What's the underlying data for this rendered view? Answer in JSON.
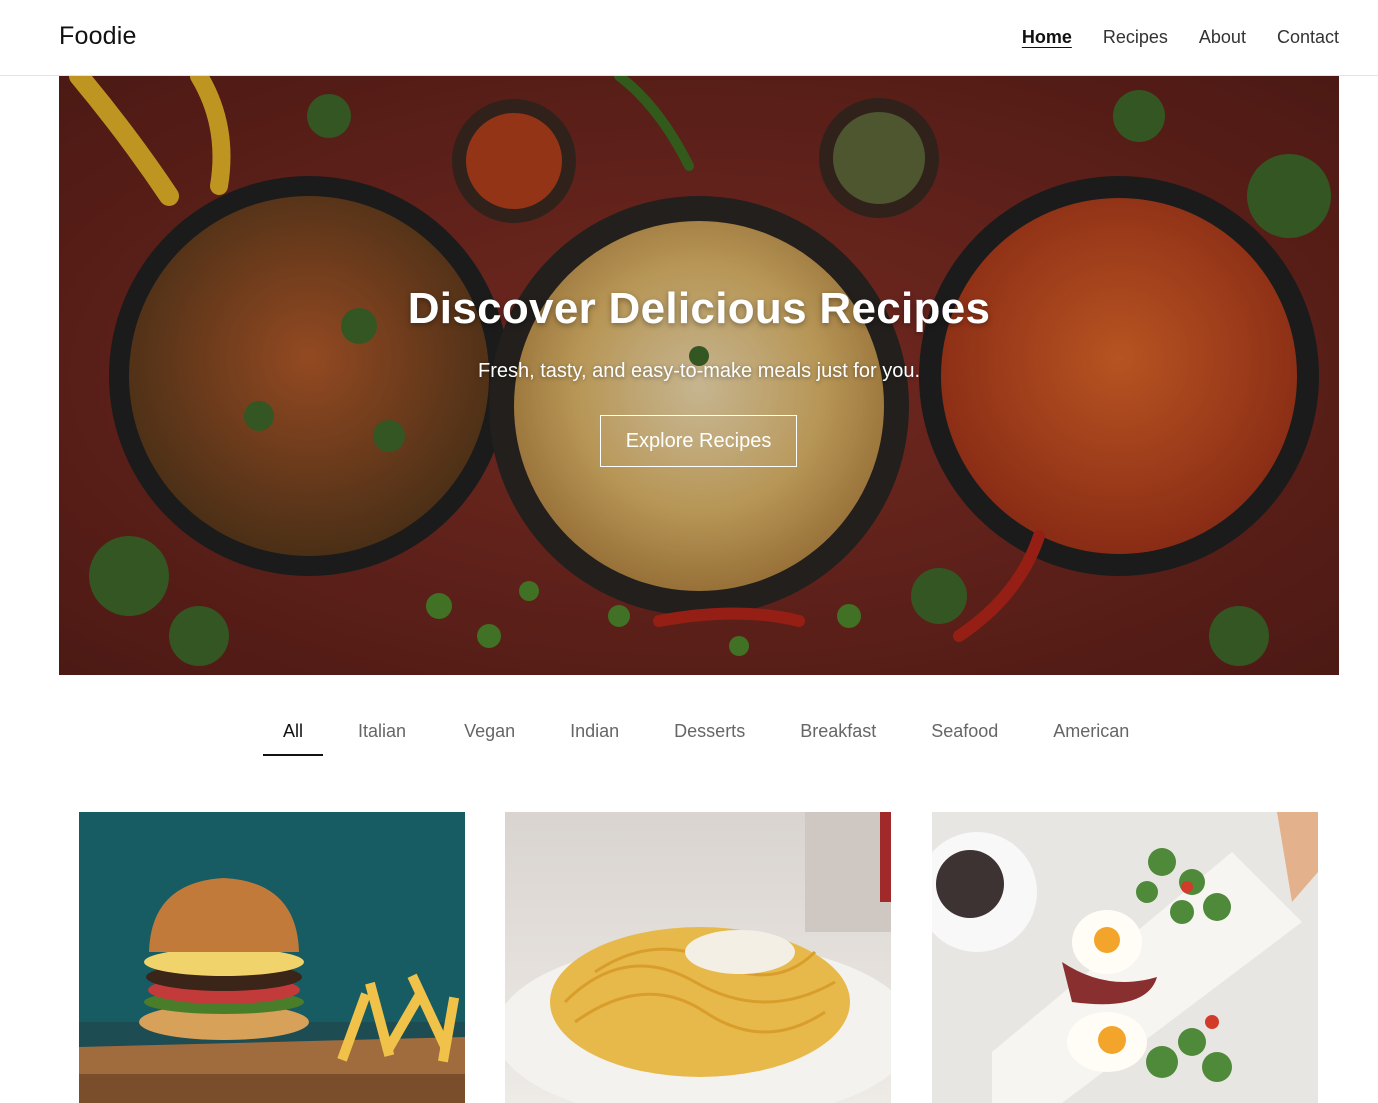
{
  "header": {
    "brand": "Foodie",
    "nav": [
      {
        "label": "Home",
        "active": true
      },
      {
        "label": "Recipes",
        "active": false
      },
      {
        "label": "About",
        "active": false
      },
      {
        "label": "Contact",
        "active": false
      }
    ]
  },
  "hero": {
    "title": "Discover Delicious Recipes",
    "subtitle": "Fresh, tasty, and easy-to-make meals just for you.",
    "cta_label": "Explore Recipes"
  },
  "filters": {
    "tabs": [
      "All",
      "Italian",
      "Vegan",
      "Indian",
      "Desserts",
      "Breakfast",
      "Seafood",
      "American"
    ],
    "active": "All"
  },
  "cards": [
    {
      "image": "burger-and-fries-photo"
    },
    {
      "image": "spaghetti-carbonara-photo"
    },
    {
      "image": "breakfast-eggs-bacon-salad-photo"
    }
  ],
  "colors": {
    "hero_background": "#7a2a22",
    "text_dark": "#111111",
    "text_muted": "#666666"
  }
}
